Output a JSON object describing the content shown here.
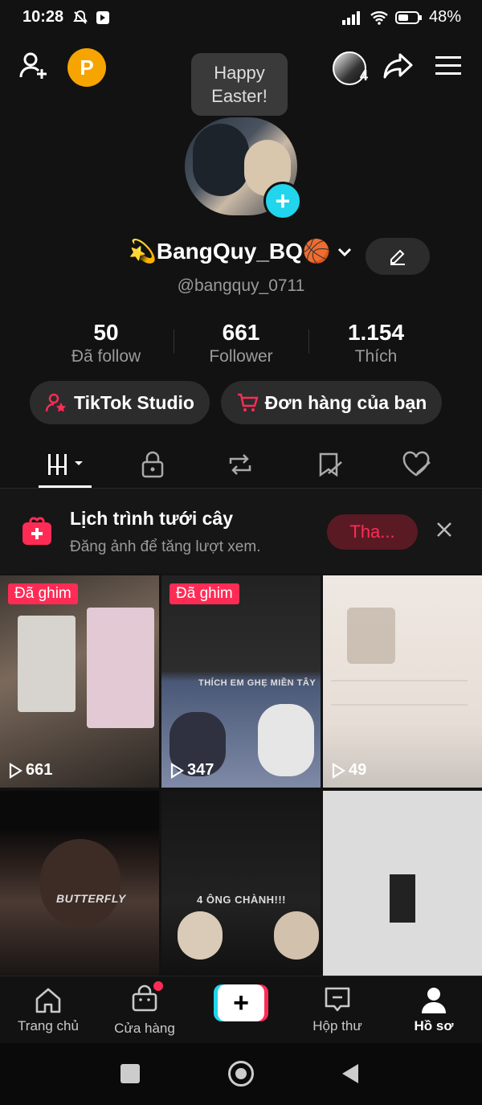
{
  "status": {
    "time": "10:28",
    "battery": "48%"
  },
  "bubble": {
    "line1": "Happy",
    "line2": "Easter!"
  },
  "coin_label": "P",
  "friends_count": "4",
  "profile": {
    "display_name": "💫BangQuy_BQ🏀",
    "username": "@bangquy_0711"
  },
  "stats": [
    {
      "num": "50",
      "label": "Đã follow"
    },
    {
      "num": "661",
      "label": "Follower"
    },
    {
      "num": "1.154",
      "label": "Thích"
    }
  ],
  "buttons": {
    "studio": "TikTok Studio",
    "orders": "Đơn hàng của bạn"
  },
  "promo": {
    "title": "Lịch trình tưới cây",
    "subtitle": "Đăng ảnh để tăng lượt xem.",
    "button": "Tha..."
  },
  "videos": [
    {
      "badge": "Đã ghim",
      "views": "661",
      "caption": ""
    },
    {
      "badge": "Đã ghim",
      "views": "347",
      "caption": "THÍCH EM GHẸ MIỀN TÂY"
    },
    {
      "badge": "",
      "views": "49",
      "caption": ""
    },
    {
      "badge": "",
      "views": "",
      "caption": "BUTTERFLY"
    },
    {
      "badge": "",
      "views": "",
      "caption": "4 ÔNG CHÀNH!!!"
    },
    {
      "badge": "",
      "views": "",
      "caption": ""
    }
  ],
  "nav": {
    "home": "Trang chủ",
    "shop": "Cửa hàng",
    "inbox": "Hộp thư",
    "profile": "Hồ sơ"
  }
}
